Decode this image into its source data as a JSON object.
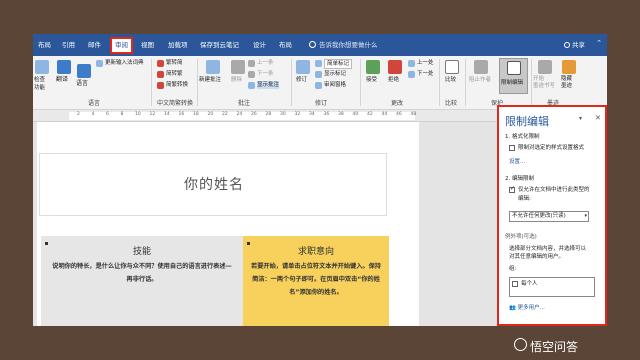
{
  "tabs": {
    "t1": "布局",
    "t2": "引用",
    "t3": "邮件",
    "t4": "审阅",
    "t5": "视图",
    "t6": "加载项",
    "t7": "保存到云笔记",
    "t8": "设计",
    "t9": "布局"
  },
  "search_placeholder": "告诉我你想要做什么",
  "share_label": "共享",
  "ribbon": {
    "check_func": "检查\n功能",
    "translate": "翻译",
    "language": "语言",
    "update_ime": "更新输入法词典",
    "trad_to_simp": "繁转简",
    "simp_to_trad": "简转繁",
    "convert": "简繁转换",
    "new_comment": "新建批注",
    "delete": "删除",
    "prev": "上一条",
    "next": "下一条",
    "show_comments": "显示批注",
    "revision": "修订",
    "simple_markup": "简单标记",
    "show_markup": "显示标记",
    "reviewing_pane": "审阅窗格",
    "accept": "接受",
    "reject": "拒绝",
    "prev_change": "上一处",
    "next_change": "下一处",
    "compare": "比较",
    "block_authors": "阻止作者",
    "restrict_editing": "限制编辑",
    "start_ink": "开始\n墨迹书写",
    "hide_ink": "隐藏\n墨迹",
    "groups": {
      "language": "语言",
      "chinese_conv": "中文简繁转换",
      "comments": "批注",
      "tracking": "修订",
      "changes": "更改",
      "compare": "比较",
      "protect": "保护",
      "ink": "墨迹"
    }
  },
  "ruler_ticks": [
    "2",
    "4",
    "6",
    "8",
    "10",
    "12",
    "14",
    "16",
    "18",
    "20",
    "22",
    "24",
    "26",
    "28",
    "30",
    "32",
    "34",
    "36",
    "38",
    "40",
    "42",
    "44",
    "46",
    "48"
  ],
  "document": {
    "name": "你的姓名",
    "left_title": "技能",
    "left_body": "说明你的特长，是什么让你与众不同？使用自己的语言进行表述—再非行话。",
    "right_title": "求职意向",
    "right_body": "若要开始，请单击占位符文本并开始键入。保持简洁：一两个句子即可。在页眉中双击“你的姓名”添加你的姓名。"
  },
  "panel": {
    "title": "限制编辑",
    "section1": "1. 格式化限制",
    "limit_format": "限制对选定的样式设置格式",
    "settings": "设置...",
    "section2": "2. 编辑限制",
    "allow_only": "仅允许在文档中进行此类型的",
    "edit_word": "编辑:",
    "select_value": "不允许任何更改(只读)",
    "exceptions": "例外项(可选)",
    "exc_desc1": "选择部分文档内容，并选择可以",
    "exc_desc2": "对其任意编辑的用户。",
    "group_label": "组:",
    "everyone": "每个人",
    "more_users": "更多用户..."
  },
  "watermark": "悟空问答",
  "colors": {
    "accent": "#2b579a",
    "highlight": "#e0281c",
    "yellow": "#f7d15c"
  }
}
